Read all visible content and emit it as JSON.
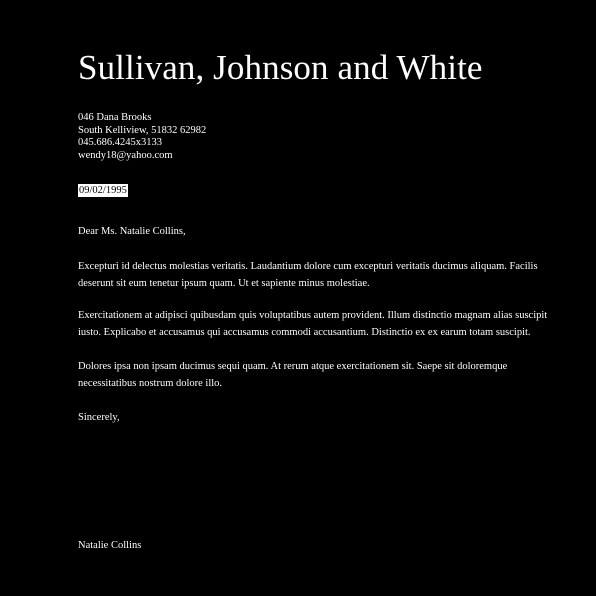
{
  "letter": {
    "company_name": "Sullivan, Johnson and White",
    "address": {
      "street": "046 Dana Brooks",
      "city_line": "South Kelliview, 51832 62982",
      "phone": "045.686.4245x3133",
      "email": "wendy18@yahoo.com"
    },
    "date": "09/02/1995",
    "salutation": "Dear Ms. Natalie Collins,",
    "paragraphs": [
      "Excepturi id delectus molestias veritatis. Laudantium dolore cum excepturi veritatis ducimus aliquam. Facilis deserunt sit eum tenetur ipsum quam. Ut et sapiente minus molestiae.",
      "Exercitationem at adipisci quibusdam quis voluptatibus autem provident. Illum distinctio magnam alias suscipit iusto. Explicabo et accusamus qui accusamus commodi accusantium. Distinctio ex ex earum totam suscipit.",
      "Dolores ipsa non ipsam ducimus sequi quam. At rerum atque exercitationem sit. Saepe sit doloremque necessitatibus nostrum dolore illo."
    ],
    "closing": "Sincerely,",
    "signature": "Natalie Collins"
  },
  "colors": {
    "background": "#000000",
    "text": "#ffffff",
    "date_highlight": "#ffffff"
  }
}
